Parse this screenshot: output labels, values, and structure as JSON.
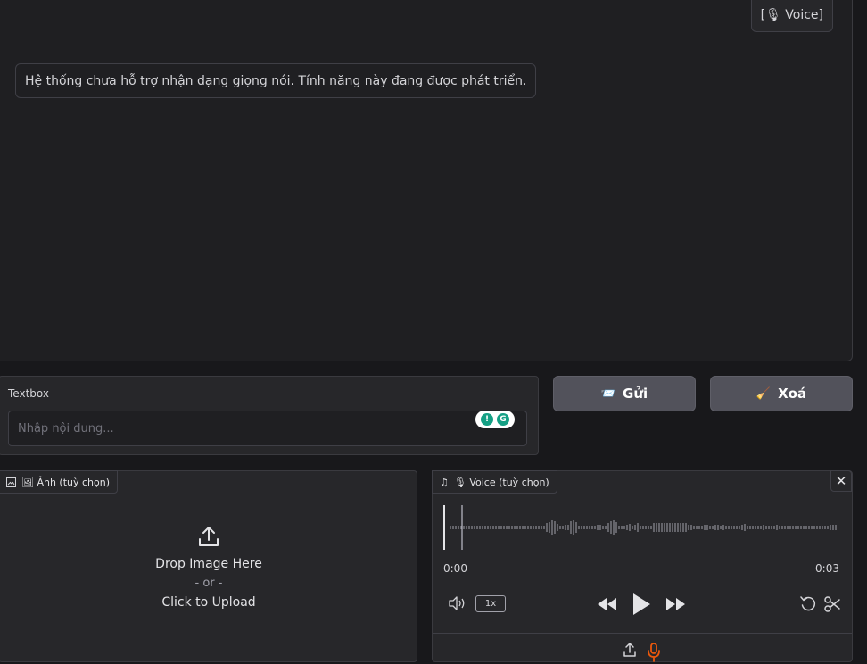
{
  "chat": {
    "user_message": "[🎙 Voice]",
    "bot_message": "Hệ thống chưa hỗ trợ nhận dạng giọng nói. Tính năng này đang được phát triển."
  },
  "textbox": {
    "label": "Textbox",
    "placeholder": "Nhập nội dung..."
  },
  "buttons": {
    "send_icon": "📨",
    "send_label": "Gửi",
    "clear_icon": "🧹",
    "clear_label": "Xoá"
  },
  "image_upload": {
    "tag_label": "🖼 Ảnh (tuỳ chọn)",
    "drop_text": "Drop Image Here",
    "or_text": "- or -",
    "click_text": "Click to Upload"
  },
  "voice": {
    "tag_label": "🎙 Voice (tuỳ chọn)",
    "time_start": "0:00",
    "time_end": "0:03",
    "speed": "1x",
    "progress": 0.0
  },
  "colors": {
    "background": "#18181b",
    "panel": "#27272a",
    "button": "#52525b",
    "mic_accent": "#ea580c"
  },
  "icons": [
    "upload-icon",
    "music-note-icon",
    "close-icon",
    "volume-icon",
    "rewind-icon",
    "play-icon",
    "fast-forward-icon",
    "reset-icon",
    "scissors-icon",
    "microphone-icon",
    "image-icon"
  ]
}
